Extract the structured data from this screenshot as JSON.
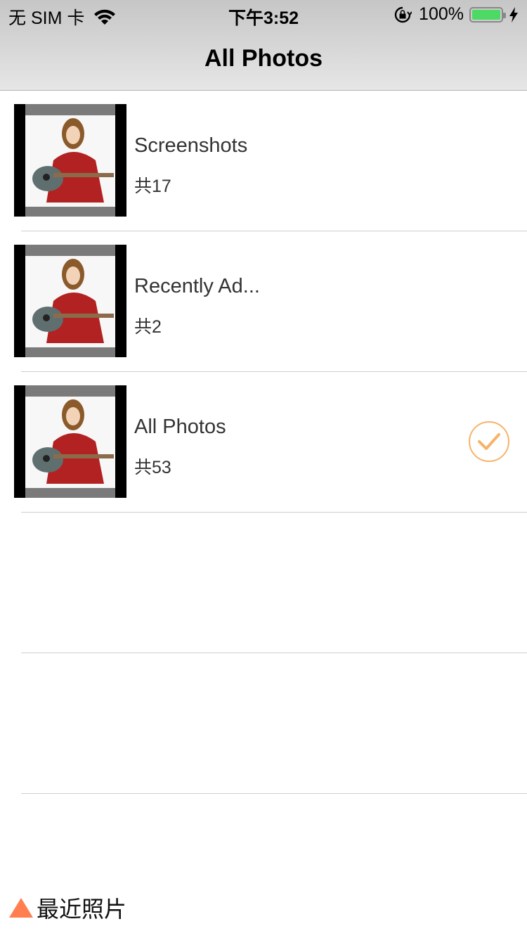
{
  "status_bar": {
    "carrier": "无 SIM 卡",
    "time": "下午3:52",
    "battery_percent": "100%",
    "battery_level": 1.0,
    "icons": [
      "wifi-icon",
      "rotation-lock-icon",
      "battery-icon",
      "charging-bolt-icon"
    ]
  },
  "nav": {
    "title": "All Photos"
  },
  "albums": [
    {
      "name": "Screenshots",
      "count": "共17",
      "selected": false
    },
    {
      "name": "Recently Ad...",
      "count": "共2",
      "selected": false
    },
    {
      "name": "All Photos",
      "count": "共53",
      "selected": true
    }
  ],
  "footer": {
    "label": "最近照片",
    "icon": "triangle-up-icon"
  },
  "colors": {
    "accent": "#f7b36a",
    "footer_icon": "#ff7f50",
    "battery": "#4cd964"
  }
}
